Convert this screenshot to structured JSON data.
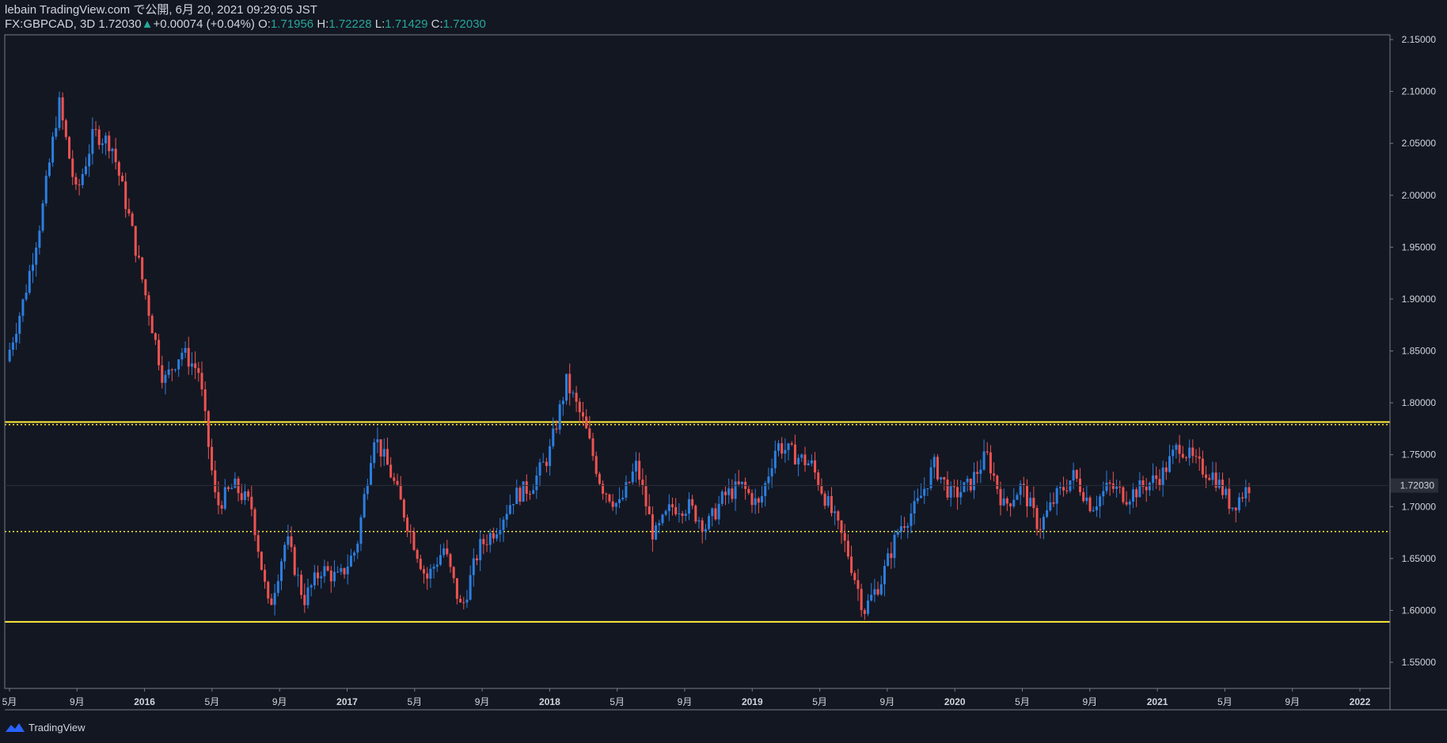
{
  "header": {
    "publish_line": "lebain TradingView.com で公開, 6月 20, 2021 09:29:05 JST",
    "symbol": "FX:GBPCAD, 3D",
    "price": "1.72030",
    "change": "+0.00074 (+0.04%)",
    "o_label": "O:",
    "o_value": "1.71956",
    "h_label": "H:",
    "h_value": "1.72228",
    "l_label": "L:",
    "l_value": "1.71429",
    "c_label": "C:",
    "c_value": "1.72030"
  },
  "footer": {
    "brand": "TradingView"
  },
  "colors": {
    "background": "#131722",
    "up": "#2b7fe0",
    "down": "#ef5350",
    "level": "#ffeb3b",
    "text": "#d1d4dc",
    "green": "#26a69a"
  },
  "chart_data": {
    "type": "line",
    "symbol": "FX:GBPCAD",
    "interval": "3D",
    "y_ticks": [
      "2.15000",
      "2.10000",
      "2.05000",
      "2.00000",
      "1.95000",
      "1.90000",
      "1.85000",
      "1.80000",
      "1.75000",
      "1.70000",
      "1.65000",
      "1.60000",
      "1.55000"
    ],
    "ylim": [
      1.52,
      2.16
    ],
    "current_price_label": "1.72030",
    "x_ticks": [
      "5月",
      "9月",
      "2016",
      "5月",
      "9月",
      "2017",
      "5月",
      "9月",
      "2018",
      "5月",
      "9月",
      "2019",
      "5月",
      "9月",
      "2020",
      "5月",
      "9月",
      "2021",
      "5月",
      "9月",
      "2022"
    ],
    "horizontal_levels": [
      {
        "value": 1.7815,
        "style": "solid"
      },
      {
        "value": 1.779,
        "style": "dotted"
      },
      {
        "value": 1.676,
        "style": "dotted"
      },
      {
        "value": 1.589,
        "style": "solid"
      }
    ],
    "series": [
      {
        "x": [
          "2015-05",
          "2015-07",
          "2015-08",
          "2015-09",
          "2015-10",
          "2015-12",
          "2016-01",
          "2016-02",
          "2016-03",
          "2016-04",
          "2016-05",
          "2016-06",
          "2016-07",
          "2016-08",
          "2016-09",
          "2016-10",
          "2016-11",
          "2016-12",
          "2017-01",
          "2017-02",
          "2017-03",
          "2017-04",
          "2017-05",
          "2017-06",
          "2017-07",
          "2017-08",
          "2017-09",
          "2017-10",
          "2017-11",
          "2017-12",
          "2018-01",
          "2018-02",
          "2018-03",
          "2018-04",
          "2018-05",
          "2018-06",
          "2018-07",
          "2018-08",
          "2018-09",
          "2018-10",
          "2018-11",
          "2018-12",
          "2019-01",
          "2019-02",
          "2019-03",
          "2019-04",
          "2019-05",
          "2019-06",
          "2019-07",
          "2019-08",
          "2019-09",
          "2019-10",
          "2019-11",
          "2019-12",
          "2020-01",
          "2020-02",
          "2020-03",
          "2020-04",
          "2020-05",
          "2020-06",
          "2020-07",
          "2020-08",
          "2020-09",
          "2020-10",
          "2020-11",
          "2020-12",
          "2021-01",
          "2021-02",
          "2021-03",
          "2021-04",
          "2021-05",
          "2021-06"
        ],
        "values": [
          1.84,
          1.9,
          1.98,
          2.09,
          2.0,
          2.06,
          2.05,
          1.98,
          1.9,
          1.82,
          1.85,
          1.83,
          1.7,
          1.72,
          1.7,
          1.6,
          1.67,
          1.61,
          1.64,
          1.63,
          1.66,
          1.77,
          1.73,
          1.68,
          1.63,
          1.66,
          1.6,
          1.66,
          1.68,
          1.71,
          1.72,
          1.75,
          1.82,
          1.78,
          1.72,
          1.7,
          1.74,
          1.67,
          1.7,
          1.7,
          1.68,
          1.71,
          1.72,
          1.7,
          1.76,
          1.75,
          1.74,
          1.7,
          1.66,
          1.6,
          1.63,
          1.68,
          1.7,
          1.74,
          1.71,
          1.72,
          1.75,
          1.7,
          1.72,
          1.68,
          1.71,
          1.73,
          1.7,
          1.72,
          1.71,
          1.72,
          1.73,
          1.76,
          1.74,
          1.73,
          1.7,
          1.72
        ]
      }
    ]
  }
}
